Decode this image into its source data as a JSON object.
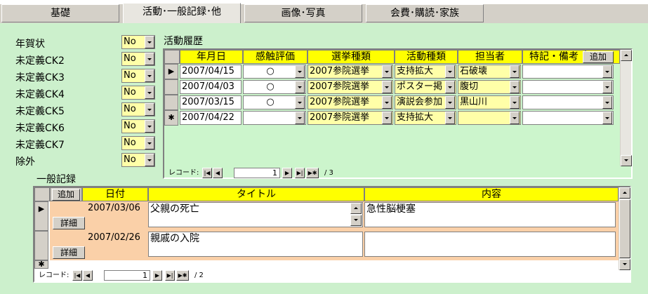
{
  "tabs": [
    "基礎",
    "活動･一般記録･他",
    "画像･写真",
    "会費･購読･家族"
  ],
  "left_fields": [
    {
      "label": "年賀状",
      "value": "No"
    },
    {
      "label": "未定義CK2",
      "value": "No"
    },
    {
      "label": "未定義CK3",
      "value": "No"
    },
    {
      "label": "未定義CK4",
      "value": "No"
    },
    {
      "label": "未定義CK5",
      "value": "No"
    },
    {
      "label": "未定義CK6",
      "value": "No"
    },
    {
      "label": "未定義CK7",
      "value": "No"
    },
    {
      "label": "除外",
      "value": "No"
    }
  ],
  "activity": {
    "title": "活動履歴",
    "headers": [
      "年月日",
      "感触評価",
      "選挙種類",
      "活動種類",
      "担当者",
      "特記・備考"
    ],
    "add_label": "追加",
    "rows": [
      {
        "selector": "▶",
        "date": "2007/04/15",
        "eval": "○",
        "election": "2007参院選挙",
        "activity": "支持拡大",
        "staff": "石破壊",
        "note": ""
      },
      {
        "selector": "",
        "date": "2007/04/03",
        "eval": "○",
        "election": "2007参院選挙",
        "activity": "ポスター掲",
        "staff": "腹切",
        "note": ""
      },
      {
        "selector": "",
        "date": "2007/03/15",
        "eval": "○",
        "election": "2007参院選挙",
        "activity": "演説会参加",
        "staff": "黒山川",
        "note": ""
      },
      {
        "selector": "✱",
        "date": "2007/04/22",
        "eval": "",
        "election": "2007参院選挙",
        "activity": "支持拡大",
        "staff": "",
        "note": ""
      }
    ],
    "nav": {
      "label": "レコード:",
      "current": "1",
      "total": "/ 3"
    }
  },
  "general": {
    "title": "一般記録",
    "add_label": "追加",
    "headers": [
      "日付",
      "タイトル",
      "内容"
    ],
    "detail_label": "詳細",
    "rows": [
      {
        "selector": "▶",
        "date": "2007/03/06",
        "title": "父親の死亡",
        "content": "急性脳梗塞"
      },
      {
        "selector": "",
        "date": "2007/02/26",
        "title": "親戚の入院",
        "content": ""
      }
    ],
    "new_selector": "✱",
    "nav": {
      "label": "レコード:",
      "current": "1",
      "total": "/ 2"
    }
  },
  "nav_icons": [
    "first-record-icon",
    "prev-record-icon",
    "next-record-icon",
    "last-record-icon",
    "new-record-icon"
  ],
  "nav_glyphs": {
    "first": "|◀",
    "prev": "◀",
    "next": "▶",
    "last": "▶|",
    "new": "▶✱"
  },
  "colors": {
    "background": "#ccf0cc",
    "header": "#ffff00",
    "field": "#ffffa8",
    "accent": "#fad0a8"
  }
}
